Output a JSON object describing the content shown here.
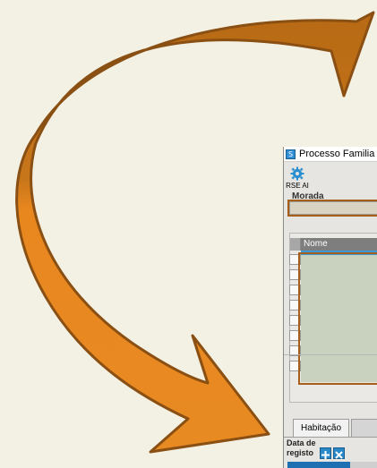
{
  "window": {
    "icon": "S",
    "title": "Processo Familia"
  },
  "toolbar": {
    "rse_button_label": "RSE AI",
    "rse_icon": "gear-icon"
  },
  "morada": {
    "label": "Morada",
    "value": ""
  },
  "grid": {
    "column_header": "Nome",
    "row_count": 8
  },
  "tabs": {
    "habitacao": "Habitação"
  },
  "form": {
    "date_label_line1": "Data de",
    "date_label_line2": "registo"
  },
  "colors": {
    "arrow_dark": "#b76a14",
    "arrow_light": "#e9871f",
    "highlight": "#a65f1a",
    "selection": "#3b97d6"
  }
}
